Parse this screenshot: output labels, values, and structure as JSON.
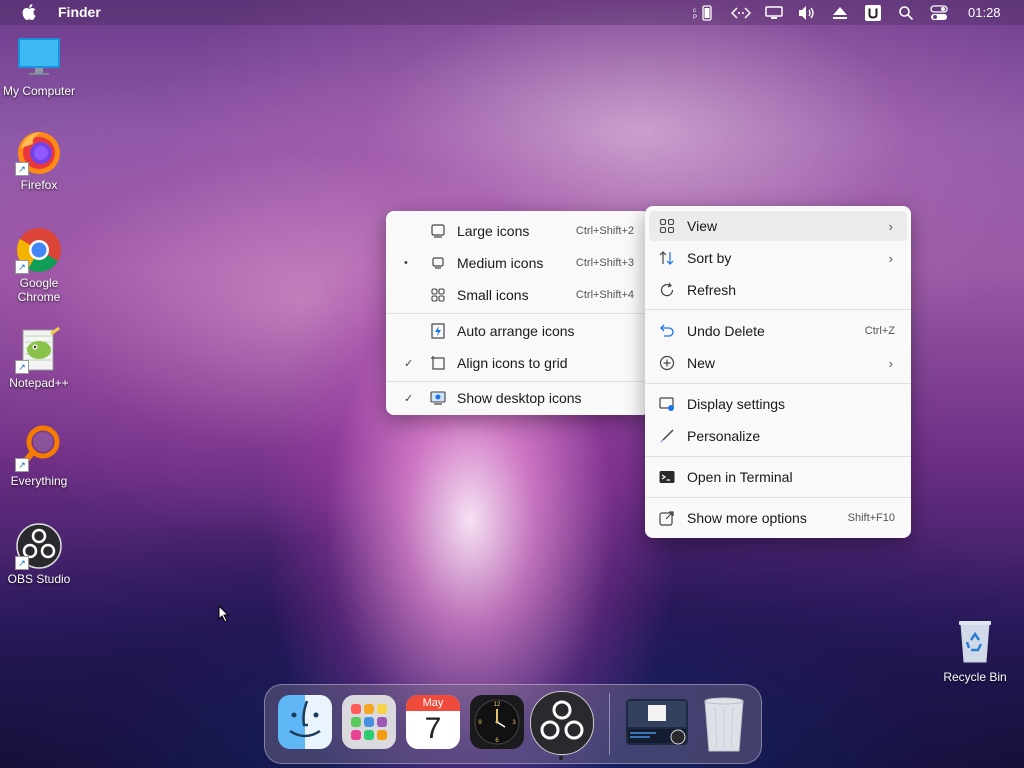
{
  "menubar": {
    "app_name": "Finder",
    "clock": "01:28",
    "tray_icons": [
      "battery-icon",
      "code-icon",
      "display-icon",
      "volume-icon",
      "eject-icon",
      "u-icon",
      "search-icon",
      "control-center-icon"
    ]
  },
  "desktop_icons": [
    {
      "label": "My Computer",
      "icon": "monitor-icon"
    },
    {
      "label": "Firefox",
      "icon": "firefox-icon"
    },
    {
      "label": "Google Chrome",
      "icon": "chrome-icon"
    },
    {
      "label": "Notepad++",
      "icon": "notepadpp-icon"
    },
    {
      "label": "Everything",
      "icon": "everything-icon"
    },
    {
      "label": "OBS Studio",
      "icon": "obs-icon"
    }
  ],
  "recycle_bin": {
    "label": "Recycle Bin"
  },
  "context_menu": {
    "items": [
      {
        "label": "View",
        "icon": "grid-icon",
        "submenu": true
      },
      {
        "label": "Sort by",
        "icon": "sort-icon",
        "submenu": true
      },
      {
        "label": "Refresh",
        "icon": "refresh-icon"
      },
      {
        "label": "Undo Delete",
        "icon": "undo-icon",
        "shortcut": "Ctrl+Z"
      },
      {
        "label": "New",
        "icon": "plus-circle-icon",
        "submenu": true
      },
      {
        "label": "Display settings",
        "icon": "display-settings-icon"
      },
      {
        "label": "Personalize",
        "icon": "brush-icon"
      },
      {
        "label": "Open in Terminal",
        "icon": "terminal-icon"
      },
      {
        "label": "Show more options",
        "icon": "share-icon",
        "shortcut": "Shift+F10"
      }
    ]
  },
  "view_submenu": {
    "items": [
      {
        "label": "Large icons",
        "shortcut": "Ctrl+Shift+2",
        "icon": "large-icons-icon"
      },
      {
        "label": "Medium icons",
        "shortcut": "Ctrl+Shift+3",
        "icon": "medium-icons-icon",
        "mark": "•"
      },
      {
        "label": "Small icons",
        "shortcut": "Ctrl+Shift+4",
        "icon": "small-icons-icon"
      },
      {
        "label": "Auto arrange icons",
        "icon": "auto-arrange-icon"
      },
      {
        "label": "Align icons to grid",
        "icon": "align-grid-icon",
        "mark": "✓"
      },
      {
        "label": "Show desktop icons",
        "icon": "show-desktop-icon",
        "mark": "✓"
      }
    ]
  },
  "dock": {
    "apps": [
      "Finder",
      "Launchpad",
      "Calendar",
      "Clock",
      "OBS Studio",
      "Window preview",
      "Trash"
    ],
    "calendar_month": "May",
    "calendar_day": "7"
  }
}
